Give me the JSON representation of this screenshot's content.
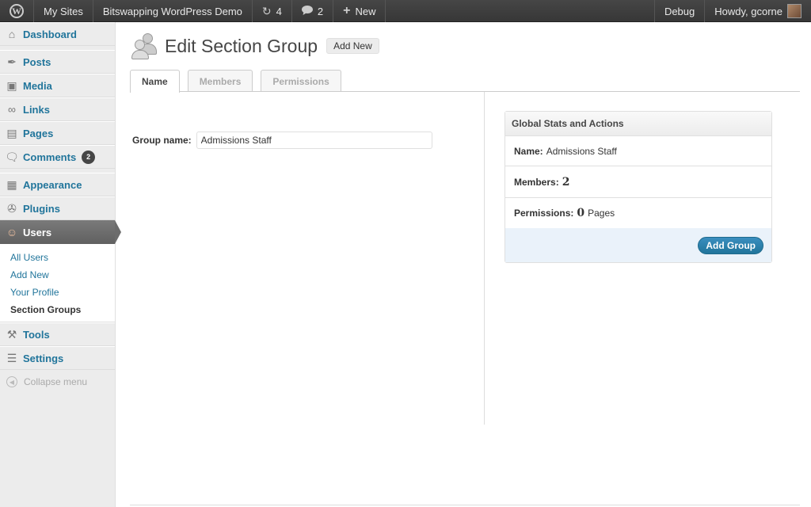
{
  "adminbar": {
    "logo": "W",
    "my_sites": "My Sites",
    "site_name": "Bitswapping WordPress Demo",
    "updates_count": "4",
    "comments_count": "2",
    "new_label": "New",
    "debug_label": "Debug",
    "howdy": "Howdy, gcorne"
  },
  "sidebar": {
    "items": [
      {
        "label": "Dashboard",
        "icon": "house-icon"
      },
      {
        "label": "Posts",
        "icon": "pin-icon"
      },
      {
        "label": "Media",
        "icon": "media-icon"
      },
      {
        "label": "Links",
        "icon": "link-icon"
      },
      {
        "label": "Pages",
        "icon": "page-icon"
      },
      {
        "label": "Comments",
        "icon": "comment-icon",
        "badge": "2"
      },
      {
        "label": "Appearance",
        "icon": "appearance-icon"
      },
      {
        "label": "Plugins",
        "icon": "plugin-icon"
      },
      {
        "label": "Users",
        "icon": "users-icon"
      },
      {
        "label": "Tools",
        "icon": "tools-icon"
      },
      {
        "label": "Settings",
        "icon": "settings-icon"
      }
    ],
    "users_submenu": [
      "All Users",
      "Add New",
      "Your Profile",
      "Section Groups"
    ],
    "collapse_label": "Collapse menu"
  },
  "main": {
    "title": "Edit Section Group",
    "add_new_label": "Add New",
    "tabs": [
      {
        "label": "Name"
      },
      {
        "label": "Members"
      },
      {
        "label": "Permissions"
      }
    ],
    "group_name_label": "Group name:",
    "group_name_value": "Admissions Staff"
  },
  "stats": {
    "header": "Global Stats and Actions",
    "name_label": "Name:",
    "name_value": "Admissions Staff",
    "members_label": "Members:",
    "members_value": "2",
    "permissions_label": "Permissions:",
    "permissions_value": "0",
    "permissions_unit": "Pages",
    "add_group_label": "Add Group"
  },
  "colors": {
    "link": "#21759b",
    "adminbar_bg": "#464646",
    "button_primary": "#21759b"
  }
}
